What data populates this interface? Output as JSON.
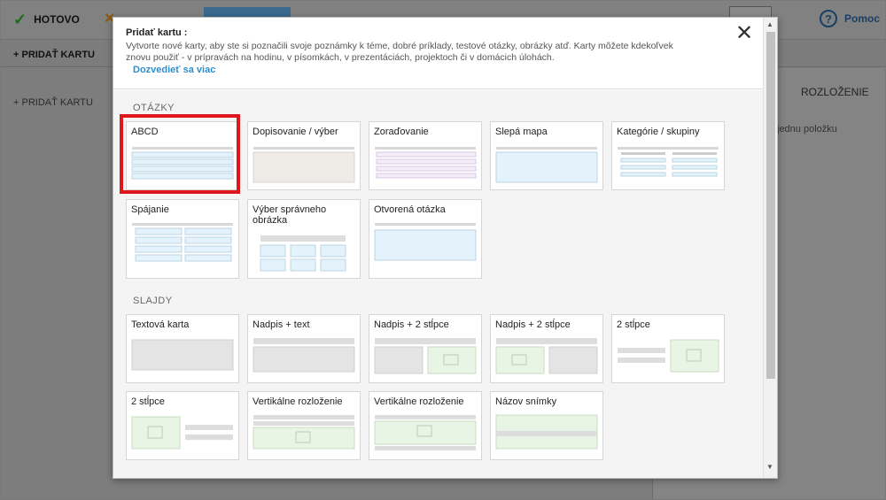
{
  "app": {
    "done_label": "HOTOVO",
    "help_label": "Pomoc",
    "add_card_top": "PRIDAŤ KARTU",
    "add_card_left": "PRIDAŤ KARTU",
    "layout_label": "ROZLOŽENIE",
    "right_hint": "jednu položku"
  },
  "modal": {
    "title": "Pridať kartu :",
    "description": "Vytvorte nové karty, aby ste si poznačili svoje poznámky k téme, dobré príklady, testové otázky, obrázky atď. Karty môžete kdekoľvek znovu použiť - v prípravách na hodinu, v písomkách, v prezentáciách, projektoch či v domácich úlohách.",
    "learn_more": "Dozvedieť sa viac",
    "sections": {
      "questions": "OTÁZKY",
      "slides": "SLAJDY"
    },
    "question_cards": [
      "ABCD",
      "Dopisovanie / výber",
      "Zoraďovanie",
      "Slepá mapa",
      "Kategórie / skupiny",
      "Spájanie",
      "Výber správneho obrázka",
      "Otvorená otázka"
    ],
    "slide_cards": [
      "Textová karta",
      "Nadpis + text",
      "Nadpis + 2 stĺpce",
      "Nadpis + 2 stĺpce",
      "2 stĺpce",
      "2 stĺpce",
      "Vertikálne rozloženie",
      "Vertikálne rozloženie",
      "Názov snímky"
    ]
  },
  "colors": {
    "highlight": "#e0161d",
    "link": "#2b8fd0",
    "preview_blue": "#e3f2fb",
    "preview_green": "#e8f4e4"
  }
}
